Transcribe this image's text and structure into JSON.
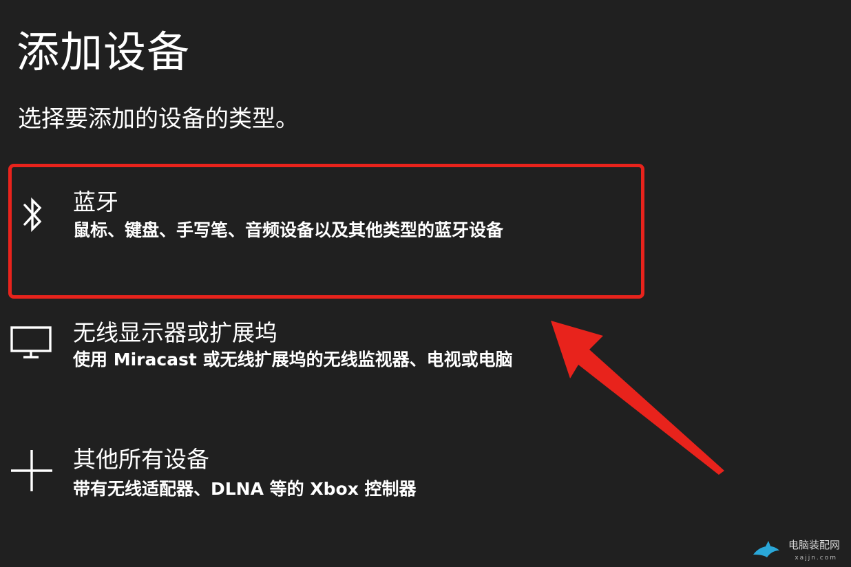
{
  "header": {
    "title": "添加设备",
    "subtitle": "选择要添加的设备的类型。"
  },
  "options": [
    {
      "icon": "bluetooth-icon",
      "title": "蓝牙",
      "description": "鼠标、键盘、手写笔、音频设备以及其他类型的蓝牙设备",
      "highlighted": true
    },
    {
      "icon": "monitor-icon",
      "title": "无线显示器或扩展坞",
      "description": "使用 Miracast 或无线扩展坞的无线监视器、电视或电脑"
    },
    {
      "icon": "plus-icon",
      "title": "其他所有设备",
      "description": "带有无线适配器、DLNA 等的 Xbox 控制器"
    }
  ],
  "annotation": {
    "color": "#e8231c"
  },
  "watermark": {
    "text": "电脑装配网",
    "url": "xajjn.com"
  }
}
